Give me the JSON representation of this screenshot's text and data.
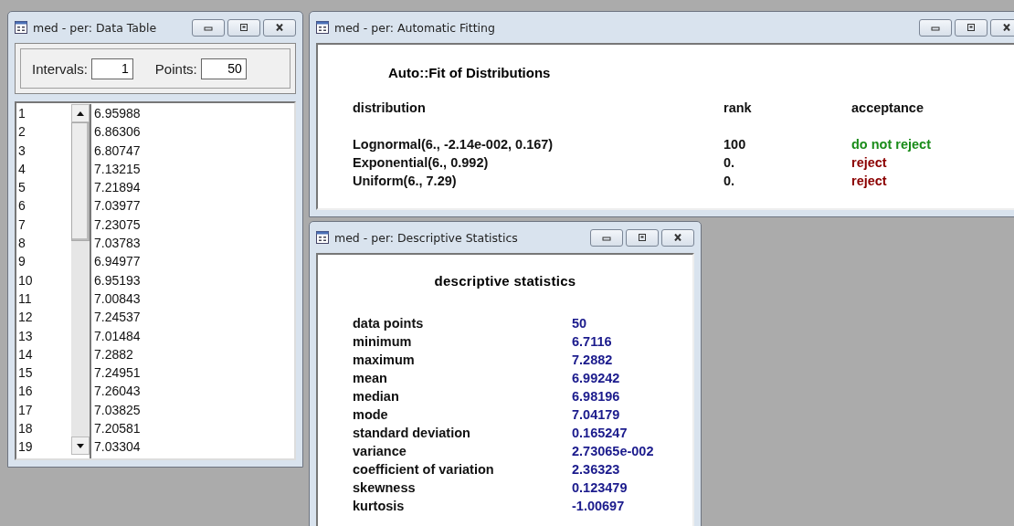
{
  "windows": [
    {
      "kind": "table",
      "title": "med - per: Data Table",
      "intervals_label": "Intervals:",
      "intervals": "1",
      "points_label": "Points:",
      "points": "50",
      "rows": [
        {
          "index": "1",
          "value": "6.95988"
        },
        {
          "index": "2",
          "value": "6.86306"
        },
        {
          "index": "3",
          "value": "6.80747"
        },
        {
          "index": "4",
          "value": "7.13215"
        },
        {
          "index": "5",
          "value": "7.21894"
        },
        {
          "index": "6",
          "value": "7.03977"
        },
        {
          "index": "7",
          "value": "7.23075"
        },
        {
          "index": "8",
          "value": "7.03783"
        },
        {
          "index": "9",
          "value": "6.94977"
        },
        {
          "index": "10",
          "value": "6.95193"
        },
        {
          "index": "11",
          "value": "7.00843"
        },
        {
          "index": "12",
          "value": "7.24537"
        },
        {
          "index": "13",
          "value": "7.01484"
        },
        {
          "index": "14",
          "value": "7.2882"
        },
        {
          "index": "15",
          "value": "7.24951"
        },
        {
          "index": "16",
          "value": "7.26043"
        },
        {
          "index": "17",
          "value": "7.03825"
        },
        {
          "index": "18",
          "value": "7.20581"
        },
        {
          "index": "19",
          "value": "7.03304"
        }
      ]
    },
    {
      "kind": "fitting",
      "title": "med - per: Automatic Fitting",
      "heading": "Auto::Fit of Distributions",
      "columns": [
        "distribution",
        "rank",
        "acceptance"
      ],
      "rows": [
        {
          "distribution": "Lognormal(6., -2.14e-002, 0.167)",
          "rank": "100",
          "acceptance": "do not reject",
          "rejected": false
        },
        {
          "distribution": "Exponential(6., 0.992)",
          "rank": "0.",
          "acceptance": "reject",
          "rejected": true
        },
        {
          "distribution": "Uniform(6., 7.29)",
          "rank": "0.",
          "acceptance": "reject",
          "rejected": true
        }
      ]
    },
    {
      "kind": "stats",
      "title": "med - per: Descriptive Statistics",
      "heading": "descriptive statistics",
      "rows": [
        {
          "label": "data points",
          "value": "50"
        },
        {
          "label": "minimum",
          "value": "6.7116"
        },
        {
          "label": "maximum",
          "value": "7.2882"
        },
        {
          "label": "mean",
          "value": "6.99242"
        },
        {
          "label": "median",
          "value": "6.98196"
        },
        {
          "label": "mode",
          "value": "7.04179"
        },
        {
          "label": "standard deviation",
          "value": "0.165247"
        },
        {
          "label": "variance",
          "value": "2.73065e-002"
        },
        {
          "label": "coefficient of variation",
          "value": "2.36323"
        },
        {
          "label": "skewness",
          "value": "0.123479"
        },
        {
          "label": "kurtosis",
          "value": "-1.00697"
        }
      ]
    }
  ]
}
